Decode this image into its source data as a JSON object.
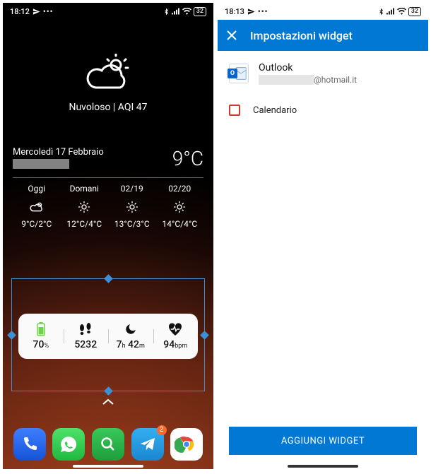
{
  "left": {
    "statusbar": {
      "time": "18:12",
      "battery": "32"
    },
    "weather": {
      "description": "Nuvoloso | AQI 47",
      "date": "Mercoledì 17 Febbraio",
      "temp": "9°C",
      "forecast": [
        {
          "label": "Oggi",
          "icon": "cloud-sun",
          "range": "9°C/2°C"
        },
        {
          "label": "Domani",
          "icon": "sun",
          "range": "12°C/4°C"
        },
        {
          "label": "02/19",
          "icon": "sun",
          "range": "13°C/3°C"
        },
        {
          "label": "02/20",
          "icon": "sun",
          "range": "14°C/4°C"
        }
      ]
    },
    "health": {
      "battery": {
        "value": "70",
        "unit": "%"
      },
      "steps": {
        "value": "5232"
      },
      "sleep": {
        "hours": "7",
        "h_unit": "h",
        "minutes": "42",
        "m_unit": "m"
      },
      "heart": {
        "value": "94",
        "unit": "bpm"
      }
    },
    "dock": {
      "telegram_badge": "2"
    }
  },
  "right": {
    "statusbar": {
      "time": "18:13",
      "battery": "32"
    },
    "appbar": {
      "title": "Impostazioni widget"
    },
    "account": {
      "name": "Outlook",
      "email_suffix": "@hotmail.it"
    },
    "options": {
      "calendar_label": "Calendario",
      "calendar_checked": false
    },
    "cta": "AGGIUNGI WIDGET"
  }
}
